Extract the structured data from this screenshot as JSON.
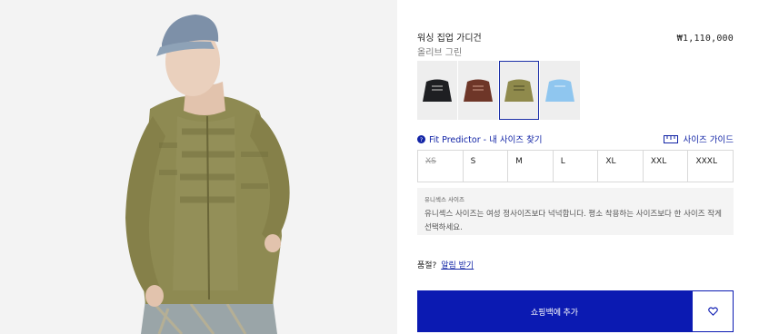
{
  "product": {
    "title": "워싱 집업 가디건",
    "price": "₩1,110,000",
    "color": "올리브 그린"
  },
  "swatches": [
    {
      "name": "black",
      "color": "#1e1f22",
      "selected": false
    },
    {
      "name": "brown",
      "color": "#6e3628",
      "selected": false
    },
    {
      "name": "olive",
      "color": "#8f8a4c",
      "selected": true
    },
    {
      "name": "light-blue",
      "color": "#8fc6ef",
      "selected": false
    }
  ],
  "fit": {
    "predictor_label": "Fit Predictor - 내 사이즈 찾기",
    "size_guide_label": "사이즈 가이드"
  },
  "sizes": [
    {
      "label": "XS",
      "available": false
    },
    {
      "label": "S",
      "available": true
    },
    {
      "label": "M",
      "available": true
    },
    {
      "label": "L",
      "available": true
    },
    {
      "label": "XL",
      "available": true
    },
    {
      "label": "XXL",
      "available": true
    },
    {
      "label": "XXXL",
      "available": true
    }
  ],
  "note": {
    "title": "유니섹스 사이즈",
    "body": "유니섹스 사이즈는 여성 정사이즈보다 넉넉합니다. 평소 착용하는 사이즈보다 한 사이즈 작게 선택하세요."
  },
  "soldout": {
    "prefix": "품절?",
    "link": "알림 받기"
  },
  "cart": {
    "add_label": "쇼핑백에 추가"
  },
  "colors": {
    "accent": "#0b1ab2",
    "link": "#1224a6"
  }
}
